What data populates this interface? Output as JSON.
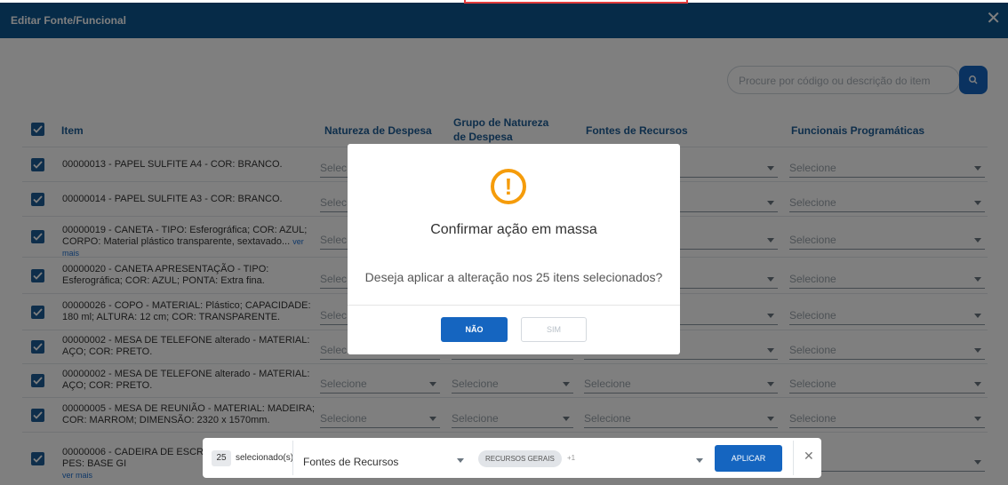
{
  "header": {
    "title": "Editar Fonte/Funcional",
    "close": "✕"
  },
  "search": {
    "placeholder": "Procure por código ou descrição do item"
  },
  "columns": {
    "item": "Item",
    "natureza": "Natureza de Despesa",
    "grupo": "Grupo de Natureza de Despesa",
    "fontes": "Fontes de Recursos",
    "funcionais": "Funcionais Programáticas"
  },
  "select_placeholder": "Selecione",
  "select_partial": "Selec",
  "rows": [
    {
      "text": "00000013 - PAPEL SULFITE A4 - COR: BRANCO."
    },
    {
      "text": "00000014 - PAPEL SULFITE A3 - COR: BRANCO."
    },
    {
      "text": "00000019 - CANETA - TIPO: Esferográfica; COR: AZUL; CORPO: Material plástico transparente, sextavado...",
      "more": "ver mais"
    },
    {
      "text": "00000020 - CANETA APRESENTAÇÃO - TIPO: Esferográfica; COR: AZUL; PONTA: Extra fina."
    },
    {
      "text": "00000026 - COPO - MATERIAL: Plástico; CAPACIDADE: 180 ml; ALTURA: 12 cm; COR: TRANSPARENTE."
    },
    {
      "text": "00000002 - MESA DE TELEFONE alterado - MATERIAL: AÇO; COR: PRETO."
    },
    {
      "text": "00000002 - MESA DE TELEFONE alterado - MATERIAL: AÇO; COR: PRETO."
    },
    {
      "text": "00000005 - MESA DE REUNIÃO - MATERIAL: MADEIRA; COR: MARROM; DIMENSÃO: 2320 x 1570mm."
    },
    {
      "text": "00000006 - CADEIRA DE ESCRITÓ ACABAMENTO DOS PES: BASE GI",
      "more": "ver mais"
    }
  ],
  "modal": {
    "icon": "!",
    "title": "Confirmar ação em massa",
    "message": "Deseja aplicar a alteração nos 25 itens selecionados?",
    "no_label": "NÃO",
    "yes_label": "SIM"
  },
  "bulk_bar": {
    "count": "25",
    "count_label": "selecionado(s)",
    "field": "Fontes de Recursos",
    "tag": "RECURSOS GERAIS",
    "tag_more": "+1",
    "apply": "APLICAR",
    "close": "✕",
    "behind_text": "e"
  },
  "colors": {
    "header": "#0d5690",
    "primary": "#1565c0",
    "warning": "#f59c0b",
    "checkbox": "#1d5d96"
  }
}
